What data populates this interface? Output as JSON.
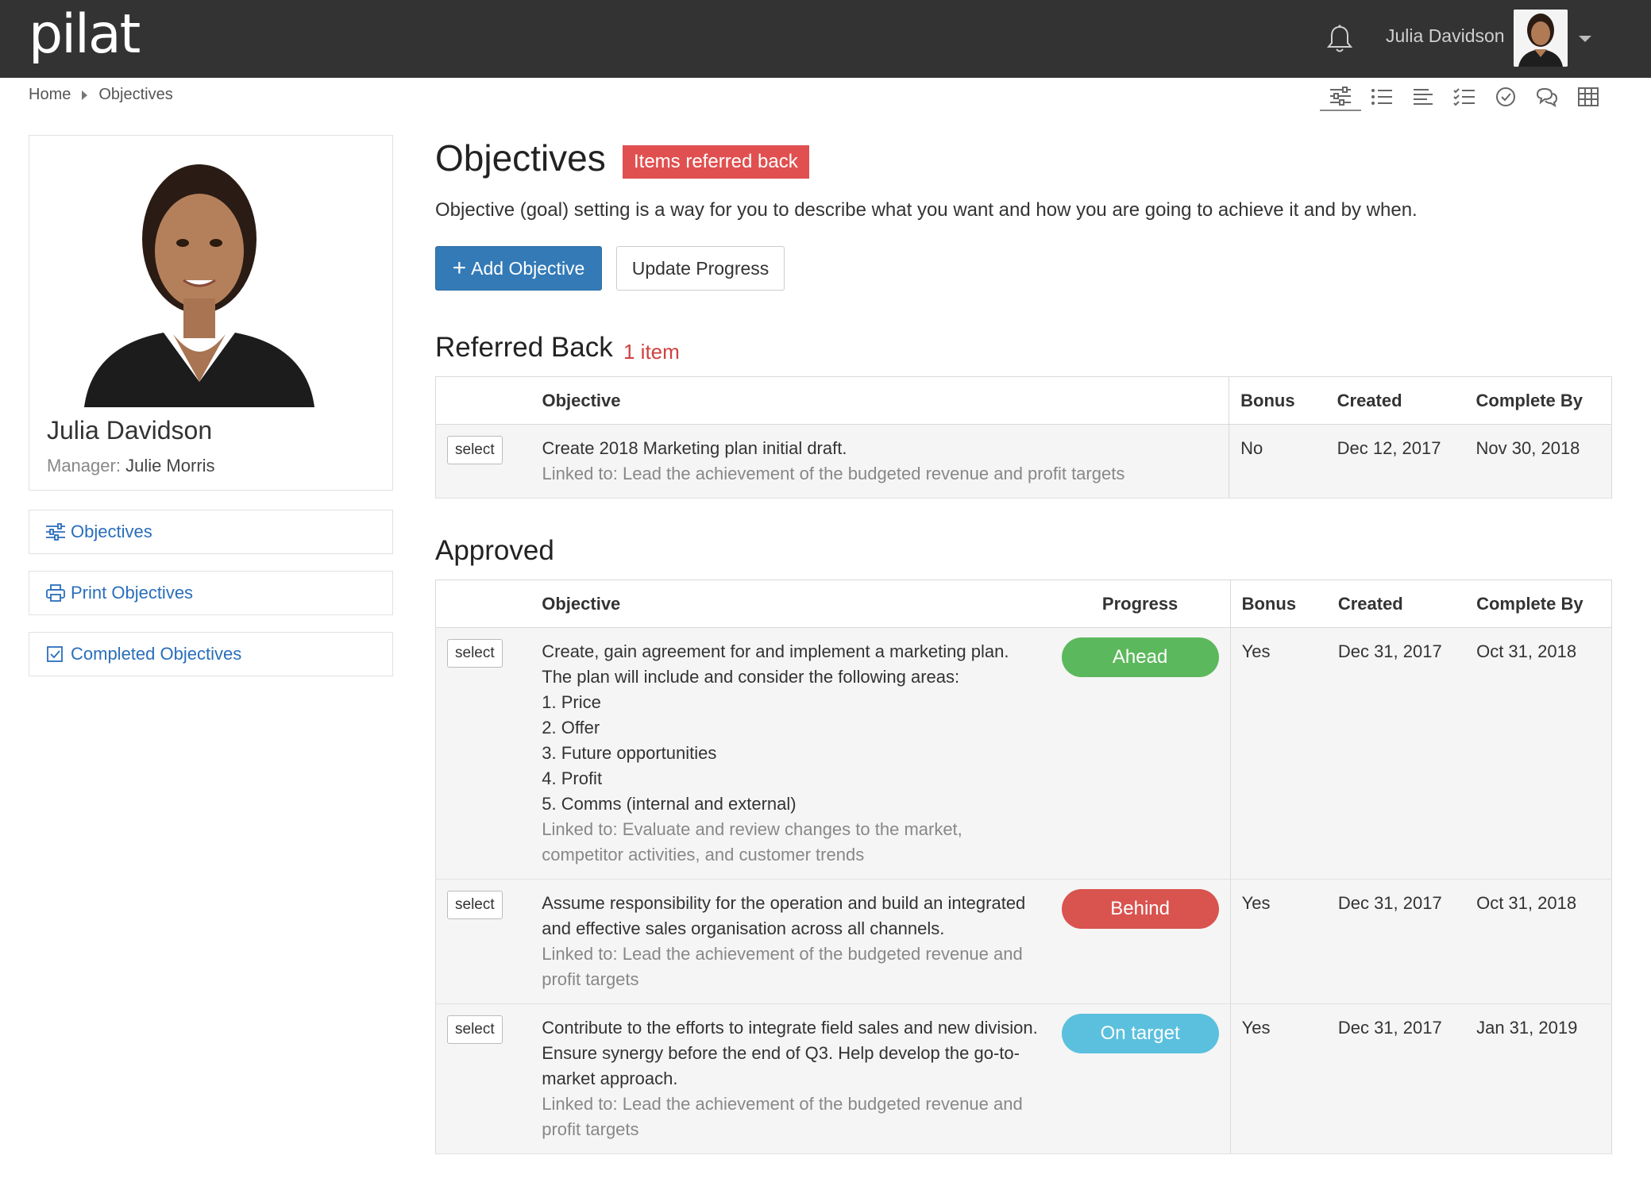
{
  "header": {
    "logo": "pilat",
    "user_name": "Julia Davidson"
  },
  "breadcrumb": [
    "Home",
    "Objectives"
  ],
  "profile": {
    "name": "Julia Davidson",
    "manager_label": "Manager:",
    "manager_name": "Julie Morris"
  },
  "sidebar": {
    "links": [
      "Objectives",
      "Print Objectives",
      "Completed Objectives"
    ]
  },
  "main": {
    "title": "Objectives",
    "badge": "Items referred back",
    "intro": "Objective (goal) setting is a way for you to describe what you want and how you are going to achieve it and by when.",
    "add_button": "Add Objective",
    "update_button": "Update Progress"
  },
  "referred_back": {
    "title": "Referred Back",
    "count": "1 item",
    "columns": {
      "objective": "Objective",
      "bonus": "Bonus",
      "created": "Created",
      "complete_by": "Complete By"
    },
    "rows": [
      {
        "select": "select",
        "objective": "Create 2018 Marketing plan initial draft.",
        "linked": "Linked to: Lead the achievement of the budgeted revenue and profit targets",
        "bonus": "No",
        "created": "Dec 12, 2017",
        "complete_by": "Nov 30, 2018"
      }
    ]
  },
  "approved": {
    "title": "Approved",
    "columns": {
      "objective": "Objective",
      "progress": "Progress",
      "bonus": "Bonus",
      "created": "Created",
      "complete_by": "Complete By"
    },
    "rows": [
      {
        "select": "select",
        "objective_lines": [
          "Create, gain agreement for and implement a marketing plan.",
          "The plan will include and consider the following areas:",
          "1. Price",
          "2. Offer",
          "3. Future opportunities",
          "4. Profit",
          "5. Comms (internal and external)"
        ],
        "linked": "Linked to: Evaluate and review changes to the market, competitor activities, and customer trends",
        "progress": "Ahead",
        "bonus": "Yes",
        "created": "Dec 31, 2017",
        "complete_by": "Oct 31, 2018"
      },
      {
        "select": "select",
        "objective_lines": [
          "Assume responsibility for the operation and build an integrated and effective sales organisation across all channels."
        ],
        "linked": "Linked to: Lead the achievement of the budgeted revenue and profit targets",
        "progress": "Behind",
        "bonus": "Yes",
        "created": "Dec 31, 2017",
        "complete_by": "Oct 31, 2018"
      },
      {
        "select": "select",
        "objective_lines": [
          "Contribute to the efforts to integrate field sales and new division. Ensure synergy before the end of Q3. Help develop the go-to-market approach."
        ],
        "linked": "Linked to: Lead the achievement of the budgeted revenue and profit targets",
        "progress": "On target",
        "bonus": "Yes",
        "created": "Dec 31, 2017",
        "complete_by": "Jan 31, 2019"
      }
    ]
  },
  "colors": {
    "header_bg": "#333333",
    "primary": "#337ab7",
    "danger": "#e05050",
    "ahead": "#5cb85c",
    "behind": "#d9534f",
    "on_target": "#5bc0de",
    "link": "#2a6ebb"
  },
  "icons": {
    "notifications": "bell-icon",
    "views": [
      "sliders-icon",
      "list-icon",
      "align-left-icon",
      "checklist-icon",
      "check-circle-icon",
      "comments-icon",
      "grid-icon"
    ]
  }
}
